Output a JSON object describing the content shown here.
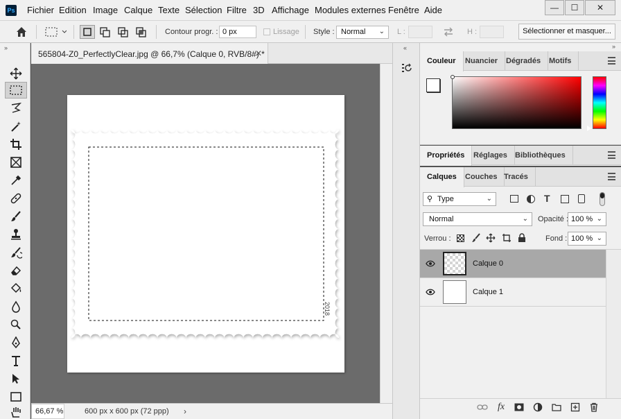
{
  "app": {
    "logo": "Ps",
    "menu": [
      "Fichier",
      "Edition",
      "Image",
      "Calque",
      "Texte",
      "Sélection",
      "Filtre",
      "3D",
      "Affichage",
      "Modules externes",
      "Fenêtre",
      "Aide"
    ],
    "window_controls": {
      "minimize": "—",
      "maximize": "☐",
      "close": "✕"
    }
  },
  "options_bar": {
    "feather_label": "Contour progr. :",
    "feather_value": "0 px",
    "antialias_label": "Lissage",
    "style_label": "Style :",
    "style_value": "Normal",
    "width_label": "L :",
    "height_label": "H :",
    "select_mask_label": "Sélectionner et masquer..."
  },
  "document": {
    "tab_title": "565804-Z0_PerfectlyClear.jpg @ 66,7% (Calque 0, RVB/8#) *",
    "tab_close": "✕",
    "stamp_year": "2018",
    "zoom": "66,67 %",
    "info": "600 px x 600 px (72 ppp)",
    "status_arrow": "›"
  },
  "color_panel": {
    "tabs": [
      "Couleur",
      "Nuancier",
      "Dégradés",
      "Motifs"
    ],
    "foreground": "#ffffff",
    "background": "#5a5a5a"
  },
  "properties_panel": {
    "tabs": [
      "Propriétés",
      "Réglages",
      "Bibliothèques"
    ]
  },
  "layers_panel": {
    "tabs": [
      "Calques",
      "Couches",
      "Tracés"
    ],
    "filter_value": "Type",
    "blend_mode": "Normal",
    "opacity_label": "Opacité :",
    "opacity_value": "100 %",
    "lock_label": "Verrou :",
    "fill_label": "Fond :",
    "fill_value": "100 %",
    "layers": [
      {
        "name": "Calque 0",
        "selected": true,
        "transparent": true
      },
      {
        "name": "Calque 1",
        "selected": false,
        "transparent": false
      }
    ],
    "footer_fx": "fx"
  }
}
